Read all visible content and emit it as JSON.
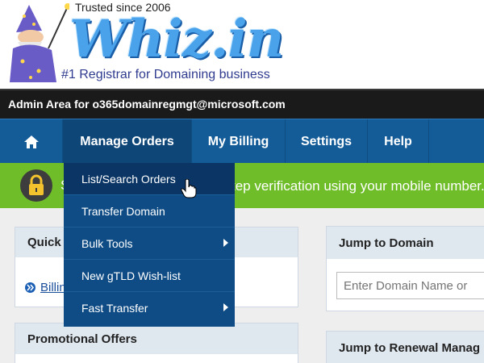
{
  "header": {
    "trusted": "Trusted since 2006",
    "logo": "Whiz.in",
    "tagline": "#1 Registrar for Domaining business"
  },
  "admin_bar": {
    "text": "Admin Area for o365domainregmgt@microsoft.com"
  },
  "nav": {
    "home_icon": "home-icon",
    "items": [
      {
        "label": "Manage Orders"
      },
      {
        "label": "My Billing"
      },
      {
        "label": "Settings"
      },
      {
        "label": "Help"
      }
    ]
  },
  "banner": {
    "prefix": "S",
    "text": "tep verification using your mobile number."
  },
  "dropdown": {
    "items": [
      {
        "label": "List/Search Orders",
        "active": true
      },
      {
        "label": "Transfer Domain"
      },
      {
        "label": "Bulk Tools",
        "submenu": true
      },
      {
        "label": "New gTLD Wish-list"
      },
      {
        "label": "Fast Transfer",
        "submenu": true
      }
    ]
  },
  "panels": {
    "quick": {
      "title": "Quick",
      "link": "Billin"
    },
    "promo": {
      "title": "Promotional Offers"
    },
    "jump": {
      "title": "Jump to Domain",
      "placeholder": "Enter Domain Name or"
    },
    "renewal": {
      "title": "Jump to Renewal Manag"
    }
  },
  "colors": {
    "nav": "#145c98",
    "nav_active": "#0e4678",
    "banner": "#6fbd29",
    "admin_bar": "#1a1a1a"
  }
}
